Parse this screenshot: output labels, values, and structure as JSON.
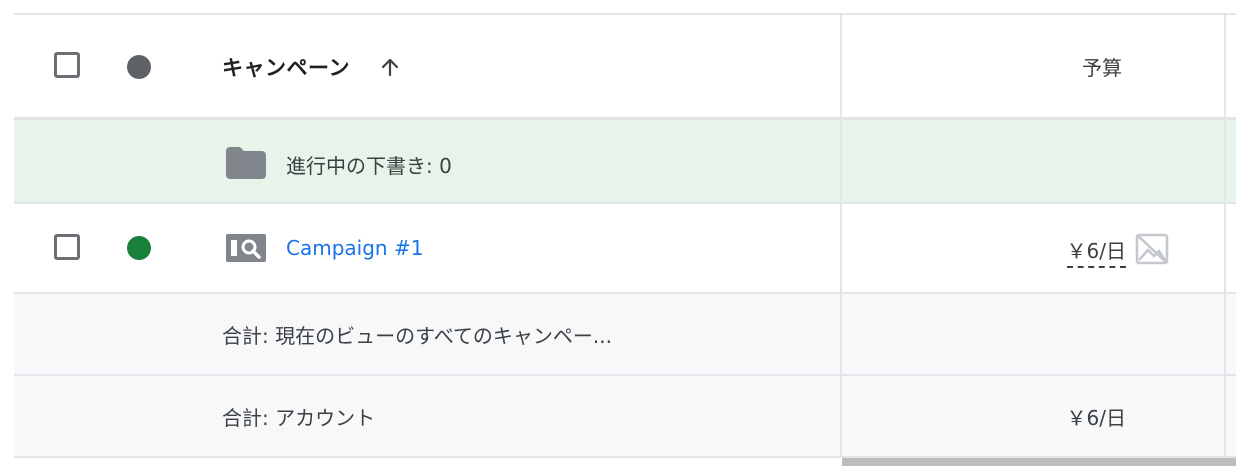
{
  "table": {
    "header": {
      "campaign_column": "キャンペーン",
      "budget_column": "予算",
      "sort_icon": "arrow-up-icon",
      "status_icon": "status-dot-gray"
    },
    "drafts_row": {
      "icon": "folder-icon",
      "label": "進行中の下書き: 0"
    },
    "campaign_row": {
      "status": "enabled",
      "status_color": "#188038",
      "type_icon": "search-campaign-icon",
      "name": "Campaign #1",
      "budget": "￥6/日",
      "budget_icon": "no-image-icon"
    },
    "total_view_row": {
      "label": "合計: 現在のビューのすべてのキャンペー..."
    },
    "total_account_row": {
      "label": "合計: アカウント",
      "budget": "￥6/日"
    }
  },
  "colors": {
    "link": "#1a73e8",
    "draft_row_bg": "#e6f4ea",
    "total_row_bg": "#f7f8fa",
    "enabled_status": "#188038"
  }
}
